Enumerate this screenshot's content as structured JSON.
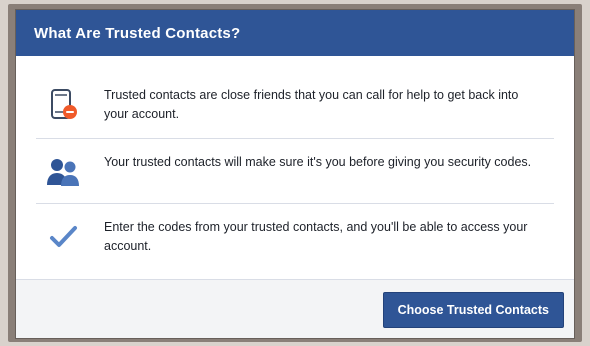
{
  "dialog": {
    "title": "What Are Trusted Contacts?",
    "items": [
      {
        "icon": "phone-unlock-icon",
        "text": "Trusted contacts are close friends that you can call for help to get back into your account."
      },
      {
        "icon": "people-icon",
        "text": "Your trusted contacts will make sure it's you before giving you security codes."
      },
      {
        "icon": "checkmark-icon",
        "text": "Enter the codes from your trusted contacts, and you'll be able to access your account."
      }
    ],
    "primary_button_label": "Choose Trusted Contacts"
  },
  "colors": {
    "header": "#2f5596",
    "button": "#2f5596",
    "accent_orange": "#f05a2a",
    "check": "#5a86c8"
  }
}
